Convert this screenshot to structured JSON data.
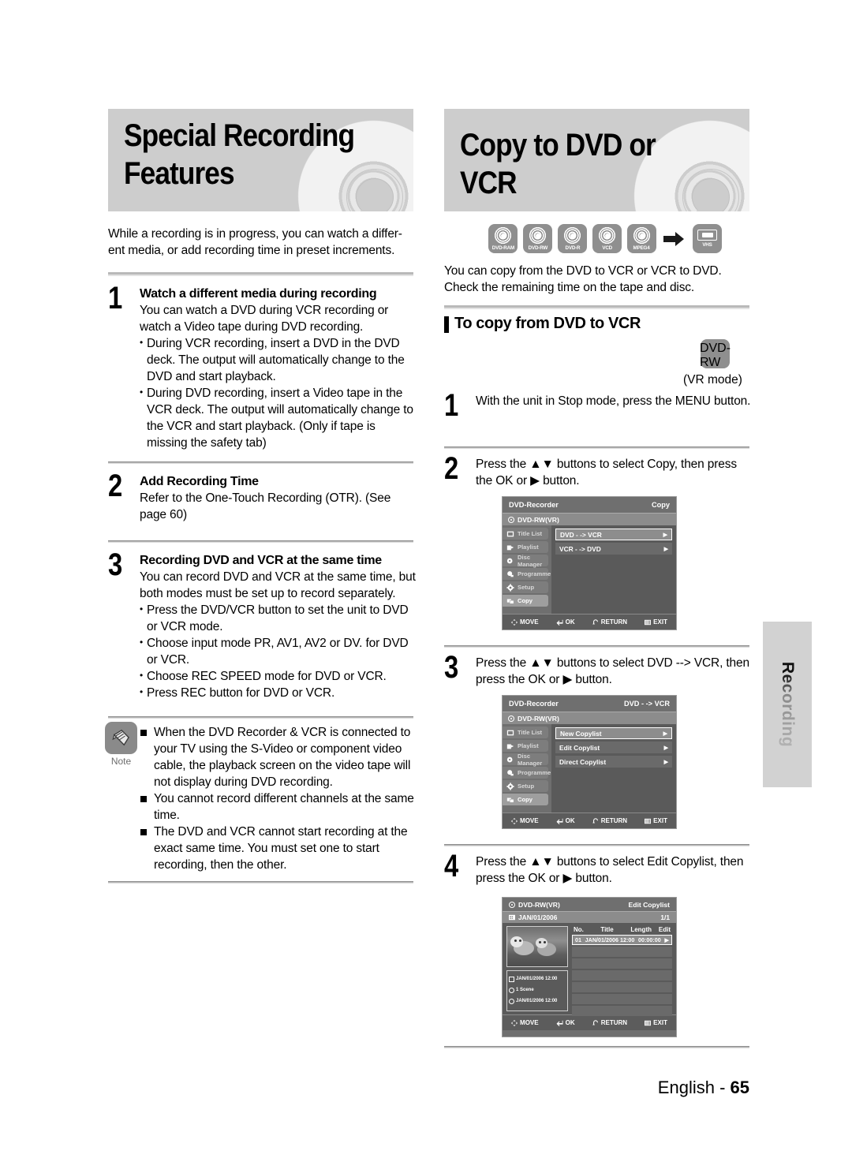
{
  "left": {
    "banner_title_line1": "Special Recording",
    "banner_title_line2": "Features",
    "intro": "While a recording is in progress, you can watch a differ-\nent media, or add recording time in preset increments.",
    "steps": [
      {
        "num": "1",
        "heading": "Watch a different media during recording",
        "body": "You can watch a DVD during VCR recording or watch a Video tape during DVD recording.",
        "bullets": [
          "During VCR recording, insert a DVD in the DVD deck. The output will automatically change to the DVD and start playback.",
          "During DVD recording, insert a Video tape in the VCR deck. The output will automatically change to the VCR and start playback. (Only if tape is missing the safety tab)"
        ]
      },
      {
        "num": "2",
        "heading": "Add Recording Time",
        "body": "Refer to the One-Touch Recording (OTR). (See page 60)",
        "bullets": []
      },
      {
        "num": "3",
        "heading": "Recording DVD and VCR at the same time",
        "body": "You can record DVD and VCR at the same time, but both modes must be set up to record separately.",
        "bullets": [
          "Press the DVD/VCR button to set the unit to DVD or VCR mode.",
          "Choose input mode PR, AV1, AV2 or DV. for DVD or VCR.",
          "Choose REC SPEED mode for DVD or VCR.",
          "Press REC button for DVD or VCR."
        ]
      }
    ],
    "note": {
      "label": "Note",
      "icon": "pencil-icon",
      "items": [
        "When the DVD Recorder & VCR is connected to your TV using the S-Video or component video cable, the playback screen on the video tape will not display during DVD recording.",
        "You cannot record different channels at the same time.",
        "The DVD and VCR cannot start recording at the exact same time. You must set one to start recording, then the other."
      ]
    }
  },
  "right": {
    "banner_title": "Copy to DVD or VCR",
    "media_chips": [
      {
        "label": "DVD-RAM",
        "icon": "disc-icon"
      },
      {
        "label": "DVD-RW",
        "icon": "disc-icon"
      },
      {
        "label": "DVD-R",
        "icon": "disc-icon"
      },
      {
        "label": "VCD",
        "icon": "disc-icon"
      },
      {
        "label": "MPEG4",
        "icon": "disc-icon"
      }
    ],
    "arrow": "arrow-right-icon",
    "target_chip": {
      "label": "VHS",
      "icon": "cassette-icon"
    },
    "intro": "You can copy from the DVD to VCR or VCR to DVD.\nCheck the remaining time on the tape and disc.",
    "section_heading": "To copy from DVD to VCR",
    "mode_chip": {
      "label": "DVD-RW",
      "icon": "disc-icon"
    },
    "mode_caption": "(VR mode)",
    "steps": [
      {
        "num": "1",
        "text": "With the unit in Stop mode, press the MENU button."
      },
      {
        "num": "2",
        "text": "Press the ▲▼ buttons to select Copy, then press the OK or ▶ button."
      },
      {
        "num": "3",
        "text": "Press the ▲▼ buttons to select DVD --> VCR, then press the OK or ▶ button."
      },
      {
        "num": "4",
        "text": "Press the ▲▼ buttons to select Edit Copylist, then press the OK or ▶ button."
      }
    ]
  },
  "osd1": {
    "title": "DVD-Recorder",
    "mode": "Copy",
    "disc": "DVD-RW(VR)",
    "menu": [
      {
        "label": "Title List",
        "selected": false,
        "icon": "titlelist-icon"
      },
      {
        "label": "Playlist",
        "selected": false,
        "icon": "playlist-icon"
      },
      {
        "label": "Disc Manager",
        "selected": false,
        "icon": "discmanager-icon"
      },
      {
        "label": "Programme",
        "selected": false,
        "icon": "programme-icon"
      },
      {
        "label": "Setup",
        "selected": false,
        "icon": "gear-icon"
      },
      {
        "label": "Copy",
        "selected": true,
        "icon": "copy-icon"
      }
    ],
    "options": [
      {
        "label": "DVD - -> VCR",
        "selected": true
      },
      {
        "label": "VCR - -> DVD",
        "selected": false
      }
    ],
    "footer": [
      {
        "label": "MOVE",
        "icon": "dpad-icon"
      },
      {
        "label": "OK",
        "icon": "enter-icon"
      },
      {
        "label": "RETURN",
        "icon": "return-icon"
      },
      {
        "label": "EXIT",
        "icon": "exit-icon"
      }
    ]
  },
  "osd2": {
    "title": "DVD-Recorder",
    "mode": "DVD - -> VCR",
    "disc": "DVD-RW(VR)",
    "menu": [
      {
        "label": "Title List",
        "selected": false,
        "icon": "titlelist-icon"
      },
      {
        "label": "Playlist",
        "selected": false,
        "icon": "playlist-icon"
      },
      {
        "label": "Disc Manager",
        "selected": false,
        "icon": "discmanager-icon"
      },
      {
        "label": "Programme",
        "selected": false,
        "icon": "programme-icon"
      },
      {
        "label": "Setup",
        "selected": false,
        "icon": "gear-icon"
      },
      {
        "label": "Copy",
        "selected": true,
        "icon": "copy-icon"
      }
    ],
    "options": [
      {
        "label": "New Copylist",
        "selected": true
      },
      {
        "label": "Edit Copylist",
        "selected": false
      },
      {
        "label": "Direct Copylist",
        "selected": false
      }
    ],
    "footer": [
      {
        "label": "MOVE",
        "icon": "dpad-icon"
      },
      {
        "label": "OK",
        "icon": "enter-icon"
      },
      {
        "label": "RETURN",
        "icon": "return-icon"
      },
      {
        "label": "EXIT",
        "icon": "exit-icon"
      }
    ]
  },
  "osd3": {
    "disc": "DVD-RW(VR)",
    "title": "Edit Copylist",
    "date": "JAN/01/2006",
    "page": "1/1",
    "columns": [
      "No.",
      "Title",
      "Length",
      "Edit"
    ],
    "rows": [
      {
        "no": "01",
        "title": "JAN/01/2006 12:00",
        "length": "00:00:00",
        "edit": "▶",
        "selected": true
      }
    ],
    "empty_rows": 6,
    "info": [
      {
        "icon": "calendar-icon",
        "text": "JAN/01/2006 12:00"
      },
      {
        "icon": "scene-icon",
        "text": "1 Scene"
      },
      {
        "icon": "clock-icon",
        "text": "JAN/01/2006 12:00"
      }
    ],
    "footer": [
      {
        "label": "MOVE",
        "icon": "dpad-icon"
      },
      {
        "label": "OK",
        "icon": "enter-icon"
      },
      {
        "label": "RETURN",
        "icon": "return-icon"
      },
      {
        "label": "EXIT",
        "icon": "exit-icon"
      }
    ]
  },
  "side_tab": "Recording",
  "footer": {
    "lang": "English - ",
    "page": "65"
  }
}
